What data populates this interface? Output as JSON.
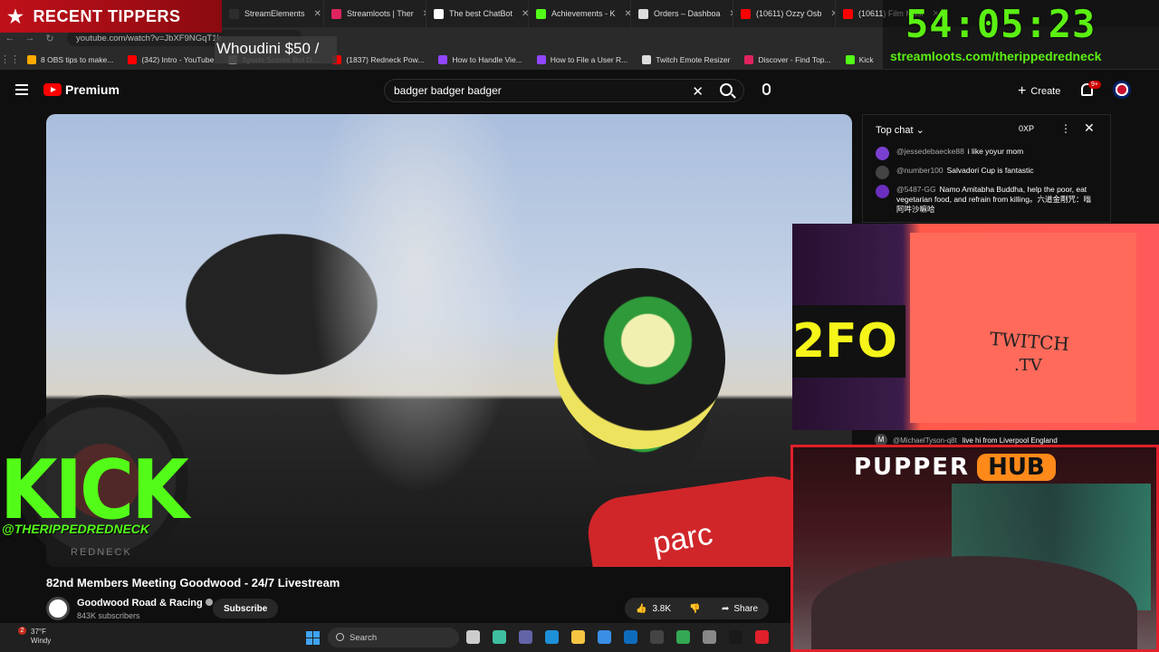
{
  "overlays": {
    "recent_tippers": "RECENT TIPPERS",
    "latest_tipper": "Whoudini $50 /",
    "timer": "54:05:23",
    "timer_url": "streamloots.com/therippedredneck",
    "kick_logo": "KICK",
    "kick_handle": "@THERIPPEDREDNECK",
    "kick_circle_text": "REDNECK",
    "cam_sign_line1": "TWITCH",
    "cam_sign_line2": ".TV",
    "cam_wall_text": "2FO",
    "pupper": "PUPPER",
    "hub": "HUB"
  },
  "browser": {
    "tabs": [
      {
        "label": "StreamElements",
        "color": "#2d2d2d"
      },
      {
        "label": "Streamloots | Ther",
        "color": "#e0245e"
      },
      {
        "label": "The best ChatBot",
        "color": "#ffffff"
      },
      {
        "label": "Achievements - K",
        "color": "#53fc18"
      },
      {
        "label": "Orders – Dashboa",
        "color": "#dddddd"
      },
      {
        "label": "(10611) Ozzy Osb",
        "color": "#ff0000"
      },
      {
        "label": "(10611) Film Musi",
        "color": "#ff0000"
      }
    ],
    "address": "youtube.com/watch?v=JbXF9NGqT1k",
    "bookmarks": [
      {
        "label": "8 OBS tips to make...",
        "color": "#ffaa00"
      },
      {
        "label": "(342) Intro - YouTube",
        "color": "#ff0000"
      },
      {
        "label": "Sports Scores Bot D...",
        "color": "#888888"
      },
      {
        "label": "(1837) Redneck Pow...",
        "color": "#ff0000"
      },
      {
        "label": "How to Handle Vie...",
        "color": "#9146ff"
      },
      {
        "label": "How to File a User R...",
        "color": "#9146ff"
      },
      {
        "label": "Twitch Emote Resizer",
        "color": "#dddddd"
      },
      {
        "label": "Discover - Find Top...",
        "color": "#e0245e"
      },
      {
        "label": "Kick",
        "color": "#53fc18"
      }
    ]
  },
  "youtube": {
    "brand": "Premium",
    "search_query": "badger badger badger",
    "create_label": "Create",
    "notif_badge": "9+",
    "video_title": "82nd Members Meeting Goodwood - 24/7 Livestream",
    "channel_name": "Goodwood Road & Racing",
    "subscribers": "843K subscribers",
    "subscribe_label": "Subscribe",
    "likes": "3.8K",
    "share_label": "Share",
    "video_overlay_text": "parc"
  },
  "chat": {
    "mode": "Top chat",
    "xp": "0XP",
    "messages": [
      {
        "user": "@jessedebaecke88",
        "text": "i like yoyur mom",
        "color": "#7b3fd1"
      },
      {
        "user": "@number100",
        "text": "Salvadori Cup is fantastic",
        "color": "#444444"
      },
      {
        "user": "@5487-GG",
        "text": "Namo Amitabha Buddha, help the poor, eat vegetarian food, and refrain from killing。六道金剛咒：嗡阿吽沙嘛哈",
        "color": "#6a2fbf"
      }
    ],
    "bottom_message": {
      "user": "@MichaelTyson-q8t",
      "text": "live hi from Liverpool England",
      "avatar_letter": "M"
    }
  },
  "taskbar": {
    "temperature": "37°F",
    "condition": "Windy",
    "weather_badge": "2",
    "search_label": "Search",
    "icons": [
      {
        "name": "task-view-icon",
        "color": "#cccccc"
      },
      {
        "name": "copilot-icon",
        "color": "#3fbf9f"
      },
      {
        "name": "teams-icon",
        "color": "#6264a7"
      },
      {
        "name": "edge-icon",
        "color": "#1e90d8"
      },
      {
        "name": "file-explorer-icon",
        "color": "#f5c542"
      },
      {
        "name": "store-icon",
        "color": "#3a8ee6"
      },
      {
        "name": "outlook-icon",
        "color": "#0f6cbd"
      },
      {
        "name": "obs-icon",
        "color": "#444444"
      },
      {
        "name": "chrome-icon",
        "color": "#34a853"
      },
      {
        "name": "app-icon",
        "color": "#888888"
      },
      {
        "name": "terminal-icon",
        "color": "#1a1a1a"
      },
      {
        "name": "app2-icon",
        "color": "#e0202a"
      }
    ]
  }
}
